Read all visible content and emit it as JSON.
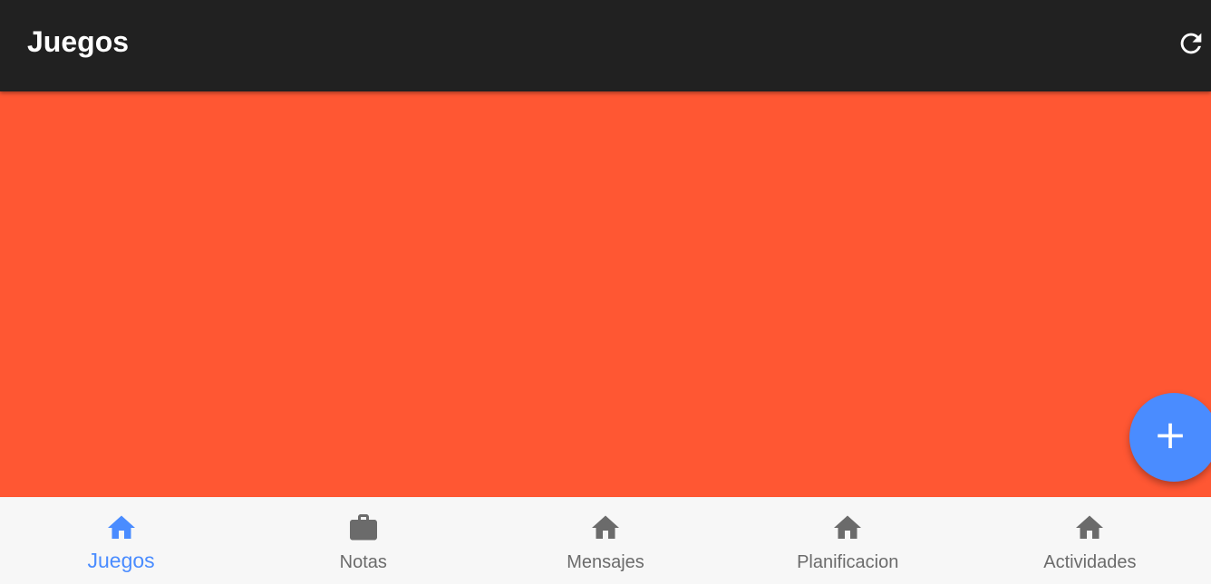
{
  "app_bar": {
    "title": "Juegos",
    "refresh_icon": "refresh-icon"
  },
  "colors": {
    "app_bar_bg": "#212121",
    "content_bg": "#ff5733",
    "accent": "#4a8cff",
    "nav_bg": "#f7f7f7",
    "nav_inactive": "#6b6b6b"
  },
  "fab": {
    "label": "+",
    "icon": "add-icon"
  },
  "bottom_nav": {
    "items": [
      {
        "label": "Juegos",
        "icon": "home-icon",
        "active": true
      },
      {
        "label": "Notas",
        "icon": "briefcase-icon",
        "active": false
      },
      {
        "label": "Mensajes",
        "icon": "home-icon",
        "active": false
      },
      {
        "label": "Planificacion",
        "icon": "home-icon",
        "active": false
      },
      {
        "label": "Actividades",
        "icon": "home-icon",
        "active": false
      }
    ]
  }
}
